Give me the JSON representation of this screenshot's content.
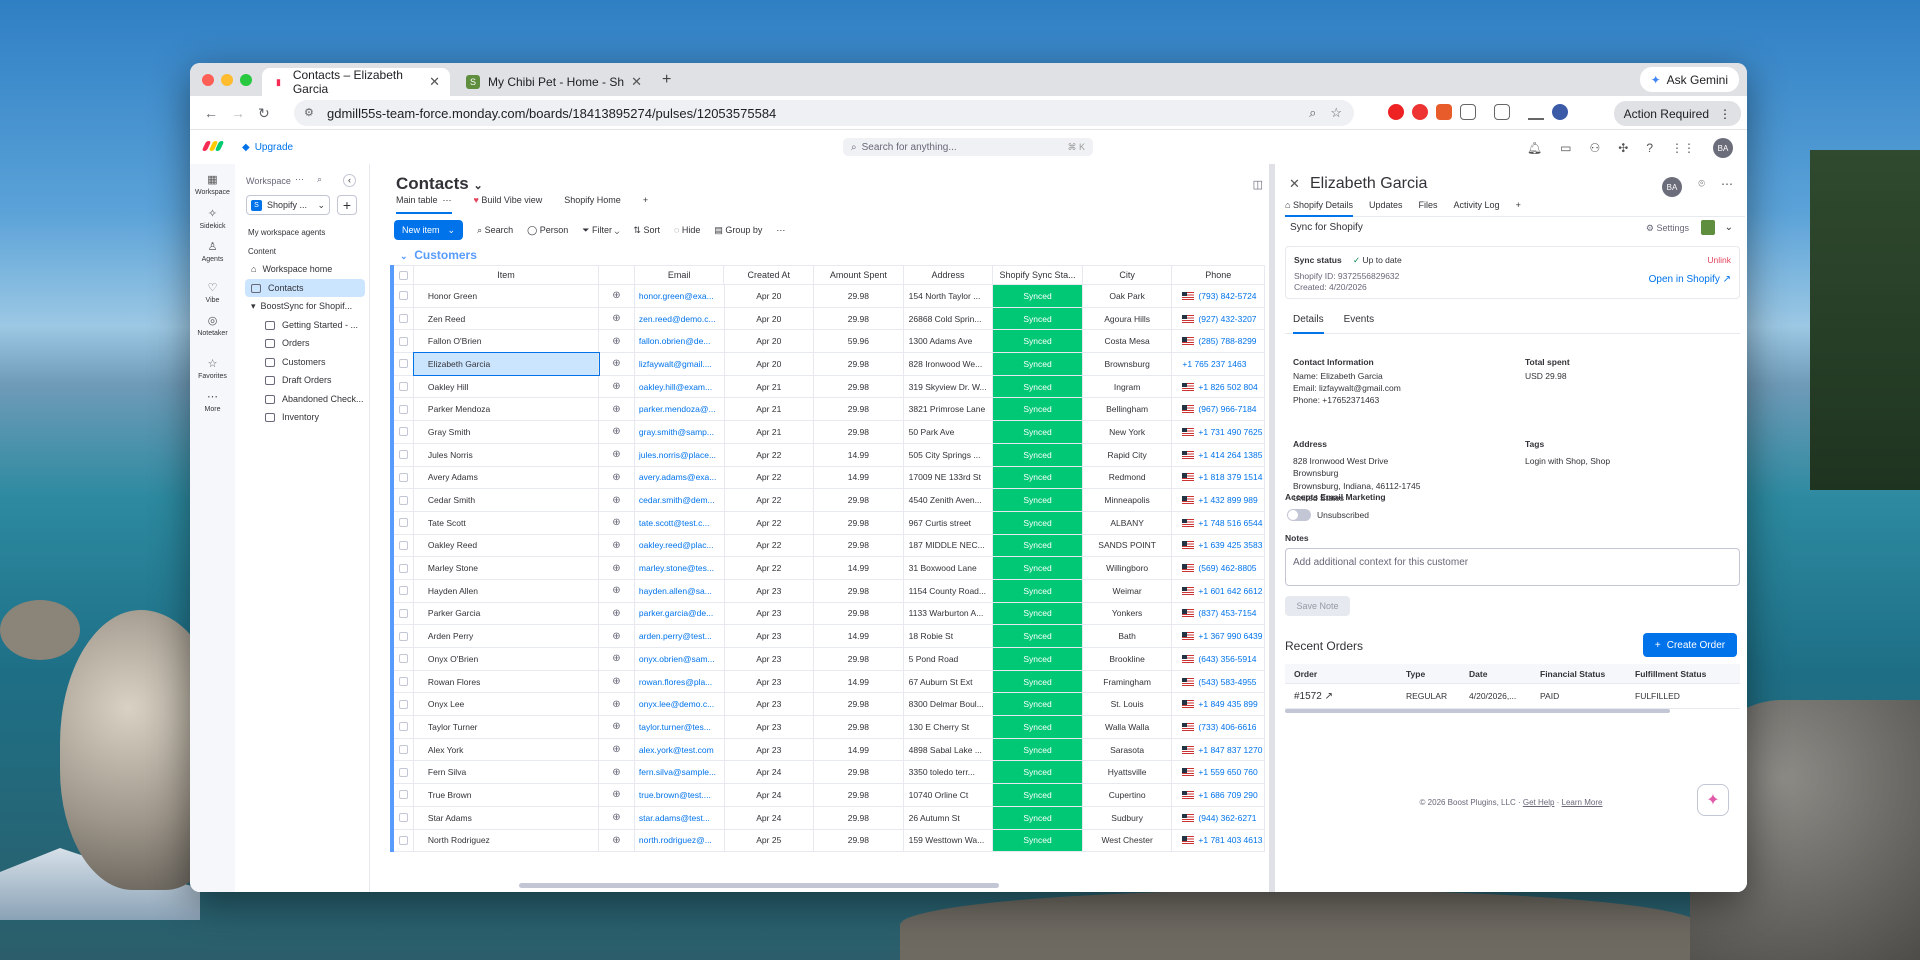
{
  "browser": {
    "tabs": [
      {
        "title": "Contacts – Elizabeth Garcia",
        "active": true
      },
      {
        "title": "My Chibi Pet - Home - Shopify",
        "active": false
      }
    ],
    "url": "gdmill55s-team-force.monday.com/boards/18413895274/pulses/12053575584",
    "ask_gemini": "Ask Gemini",
    "action_required": "Action Required"
  },
  "topbar": {
    "upgrade": "Upgrade",
    "search_placeholder": "Search for anything...",
    "search_shortcut": "⌘ K",
    "avatar": "BA"
  },
  "rail": [
    {
      "label": "Workspace",
      "icon": "grid-icon"
    },
    {
      "label": "Sidekick",
      "icon": "sparkle-icon"
    },
    {
      "label": "Agents",
      "icon": "agent-icon"
    },
    {
      "label": "Vibe",
      "icon": "heart-icon"
    },
    {
      "label": "Notetaker",
      "icon": "notetaker-icon"
    },
    {
      "label": "Favorites",
      "icon": "star-icon"
    },
    {
      "label": "More",
      "icon": "more-icon"
    }
  ],
  "workspace": {
    "title": "Workspace",
    "selector": "Shopify ...",
    "agents": "My workspace agents",
    "content": "Content",
    "items": [
      {
        "label": "Workspace home"
      },
      {
        "label": "Contacts"
      },
      {
        "label": "BoostSync for Shopif..."
      },
      {
        "label": "Getting Started - ..."
      },
      {
        "label": "Orders"
      },
      {
        "label": "Customers"
      },
      {
        "label": "Draft Orders"
      },
      {
        "label": "Abandoned Check..."
      },
      {
        "label": "Inventory"
      }
    ]
  },
  "board": {
    "title": "Contacts",
    "views": [
      "Main table",
      "Build Vibe view",
      "Shopify Home"
    ],
    "toolbar": {
      "new_item": "New item",
      "search": "Search",
      "person": "Person",
      "filter": "Filter",
      "sort": "Sort",
      "hide": "Hide",
      "group_by": "Group by"
    },
    "group": "Customers",
    "columns": [
      "Item",
      "Email",
      "Created At",
      "Amount Spent",
      "Address",
      "Shopify Sync Sta...",
      "City",
      "Phone"
    ],
    "rows": [
      {
        "item": "Honor Green",
        "email": "honor.green@exa...",
        "date": "Apr 20",
        "amount": "29.98",
        "address": "154 North Taylor ...",
        "sync": "Synced",
        "city": "Oak Park",
        "phone": "(793) 842-5724",
        "flag": true
      },
      {
        "item": "Zen Reed",
        "email": "zen.reed@demo.c...",
        "date": "Apr 20",
        "amount": "29.98",
        "address": "26868 Cold Sprin...",
        "sync": "Synced",
        "city": "Agoura Hills",
        "phone": "(927) 432-3207",
        "flag": true
      },
      {
        "item": "Fallon O'Brien",
        "email": "fallon.obrien@de...",
        "date": "Apr 20",
        "amount": "59.96",
        "address": "1300 Adams Ave",
        "sync": "Synced",
        "city": "Costa Mesa",
        "phone": "(285) 788-8299",
        "flag": true
      },
      {
        "item": "Elizabeth Garcia",
        "email": "lizfaywalt@gmail....",
        "date": "Apr 20",
        "amount": "29.98",
        "address": "828 Ironwood We...",
        "sync": "Synced",
        "city": "Brownsburg",
        "phone": "+1 765 237 1463",
        "flag": false,
        "selected": true
      },
      {
        "item": "Oakley Hill",
        "email": "oakley.hill@exam...",
        "date": "Apr 21",
        "amount": "29.98",
        "address": "319 Skyview Dr. W...",
        "sync": "Synced",
        "city": "Ingram",
        "phone": "+1 826 502 804",
        "flag": true
      },
      {
        "item": "Parker Mendoza",
        "email": "parker.mendoza@...",
        "date": "Apr 21",
        "amount": "29.98",
        "address": "3821 Primrose Lane",
        "sync": "Synced",
        "city": "Bellingham",
        "phone": "(967) 966-7184",
        "flag": true
      },
      {
        "item": "Gray Smith",
        "email": "gray.smith@samp...",
        "date": "Apr 21",
        "amount": "29.98",
        "address": "50 Park Ave",
        "sync": "Synced",
        "city": "New York",
        "phone": "+1 731 490 7625",
        "flag": true
      },
      {
        "item": "Jules Norris",
        "email": "jules.norris@place...",
        "date": "Apr 22",
        "amount": "14.99",
        "address": "505 City Springs ...",
        "sync": "Synced",
        "city": "Rapid City",
        "phone": "+1 414 264 1385",
        "flag": true
      },
      {
        "item": "Avery Adams",
        "email": "avery.adams@exa...",
        "date": "Apr 22",
        "amount": "14.99",
        "address": "17009 NE 133rd St",
        "sync": "Synced",
        "city": "Redmond",
        "phone": "+1 818 379 1514",
        "flag": true
      },
      {
        "item": "Cedar Smith",
        "email": "cedar.smith@dem...",
        "date": "Apr 22",
        "amount": "29.98",
        "address": "4540 Zenith Aven...",
        "sync": "Synced",
        "city": "Minneapolis",
        "phone": "+1 432 899 989",
        "flag": true
      },
      {
        "item": "Tate Scott",
        "email": "tate.scott@test.c...",
        "date": "Apr 22",
        "amount": "29.98",
        "address": "967 Curtis street",
        "sync": "Synced",
        "city": "ALBANY",
        "phone": "+1 748 516 6544",
        "flag": true
      },
      {
        "item": "Oakley Reed",
        "email": "oakley.reed@plac...",
        "date": "Apr 22",
        "amount": "29.98",
        "address": "187 MIDDLE NEC...",
        "sync": "Synced",
        "city": "SANDS POINT",
        "phone": "+1 639 425 3583",
        "flag": true
      },
      {
        "item": "Marley Stone",
        "email": "marley.stone@tes...",
        "date": "Apr 22",
        "amount": "14.99",
        "address": "31 Boxwood Lane",
        "sync": "Synced",
        "city": "Willingboro",
        "phone": "(569) 462-8805",
        "flag": true
      },
      {
        "item": "Hayden Allen",
        "email": "hayden.allen@sa...",
        "date": "Apr 23",
        "amount": "29.98",
        "address": "1154 County Road...",
        "sync": "Synced",
        "city": "Weimar",
        "phone": "+1 601 642 6612",
        "flag": true
      },
      {
        "item": "Parker Garcia",
        "email": "parker.garcia@de...",
        "date": "Apr 23",
        "amount": "29.98",
        "address": "1133 Warburton A...",
        "sync": "Synced",
        "city": "Yonkers",
        "phone": "(837) 453-7154",
        "flag": true
      },
      {
        "item": "Arden Perry",
        "email": "arden.perry@test...",
        "date": "Apr 23",
        "amount": "14.99",
        "address": "18 Robie St",
        "sync": "Synced",
        "city": "Bath",
        "phone": "+1 367 990 6439",
        "flag": true
      },
      {
        "item": "Onyx O'Brien",
        "email": "onyx.obrien@sam...",
        "date": "Apr 23",
        "amount": "29.98",
        "address": "5 Pond Road",
        "sync": "Synced",
        "city": "Brookline",
        "phone": "(643) 356-5914",
        "flag": true
      },
      {
        "item": "Rowan Flores",
        "email": "rowan.flores@pla...",
        "date": "Apr 23",
        "amount": "14.99",
        "address": "67 Auburn St Ext",
        "sync": "Synced",
        "city": "Framingham",
        "phone": "(543) 583-4955",
        "flag": true
      },
      {
        "item": "Onyx Lee",
        "email": "onyx.lee@demo.c...",
        "date": "Apr 23",
        "amount": "29.98",
        "address": "8300 Delmar Boul...",
        "sync": "Synced",
        "city": "St. Louis",
        "phone": "+1 849 435 899",
        "flag": true
      },
      {
        "item": "Taylor Turner",
        "email": "taylor.turner@tes...",
        "date": "Apr 23",
        "amount": "29.98",
        "address": "130 E Cherry St",
        "sync": "Synced",
        "city": "Walla Walla",
        "phone": "(733) 406-6616",
        "flag": true
      },
      {
        "item": "Alex York",
        "email": "alex.york@test.com",
        "date": "Apr 23",
        "amount": "14.99",
        "address": "4898 Sabal Lake ...",
        "sync": "Synced",
        "city": "Sarasota",
        "phone": "+1 847 837 1270",
        "flag": true
      },
      {
        "item": "Fern Silva",
        "email": "fern.silva@sample...",
        "date": "Apr 24",
        "amount": "29.98",
        "address": "3350 toledo terr...",
        "sync": "Synced",
        "city": "Hyattsville",
        "phone": "+1 559 650 760",
        "flag": true
      },
      {
        "item": "True Brown",
        "email": "true.brown@test....",
        "date": "Apr 24",
        "amount": "29.98",
        "address": "10740 Orline Ct",
        "sync": "Synced",
        "city": "Cupertino",
        "phone": "+1 686 709 290",
        "flag": true
      },
      {
        "item": "Star Adams",
        "email": "star.adams@test...",
        "date": "Apr 24",
        "amount": "29.98",
        "address": "26 Autumn St",
        "sync": "Synced",
        "city": "Sudbury",
        "phone": "(944) 362-6271",
        "flag": true
      },
      {
        "item": "North Rodriguez",
        "email": "north.rodriguez@...",
        "date": "Apr 25",
        "amount": "29.98",
        "address": "159 Westtown Wa...",
        "sync": "Synced",
        "city": "West Chester",
        "phone": "+1 781 403 4613",
        "flag": true
      }
    ]
  },
  "panel": {
    "name": "Elizabeth Garcia",
    "avatar": "BA",
    "tabs": [
      "Shopify Details",
      "Updates",
      "Files",
      "Activity Log"
    ],
    "sync_for_shopify": "Sync for Shopify",
    "settings": "Settings",
    "sync_status_label": "Sync status",
    "sync_status": "Up to date",
    "unlink": "Unlink",
    "shopify_id": "Shopify ID: 9372556829632",
    "created": "Created: 4/20/2026",
    "open_in_shopify": "Open in Shopify",
    "subtabs": [
      "Details",
      "Events"
    ],
    "contact_info_label": "Contact Information",
    "contact_name": "Name: Elizabeth Garcia",
    "contact_email": "Email: lizfaywalt@gmail.com",
    "contact_phone": "Phone: +17652371463",
    "total_spent_label": "Total spent",
    "total_spent": "USD 29.98",
    "address_label": "Address",
    "address_lines": [
      "828 Ironwood West Drive",
      "Brownsburg",
      "Brownsburg, Indiana, 46112-1745",
      "United States"
    ],
    "tags_label": "Tags",
    "tags": "Login with Shop, Shop",
    "email_marketing_label": "Accepts Email Marketing",
    "email_marketing": "Unsubscribed",
    "notes_label": "Notes",
    "notes_placeholder": "Add additional context for this customer",
    "save_note": "Save Note",
    "recent_orders": "Recent Orders",
    "create_order": "Create Order",
    "order_headers": [
      "Order",
      "Type",
      "Date",
      "Financial Status",
      "Fulfillment Status"
    ],
    "orders": [
      {
        "order": "#1572",
        "type": "REGULAR",
        "date": "4/20/2026,...",
        "financial": "PAID",
        "fulfillment": "FULFILLED"
      }
    ],
    "footer_copy": "© 2026 Boost Plugins, LLC",
    "footer_help": "Get Help",
    "footer_learn": "Learn More"
  },
  "colors": {
    "accent": "#0073ea",
    "synced": "#00c875",
    "group": "#579bfc"
  }
}
